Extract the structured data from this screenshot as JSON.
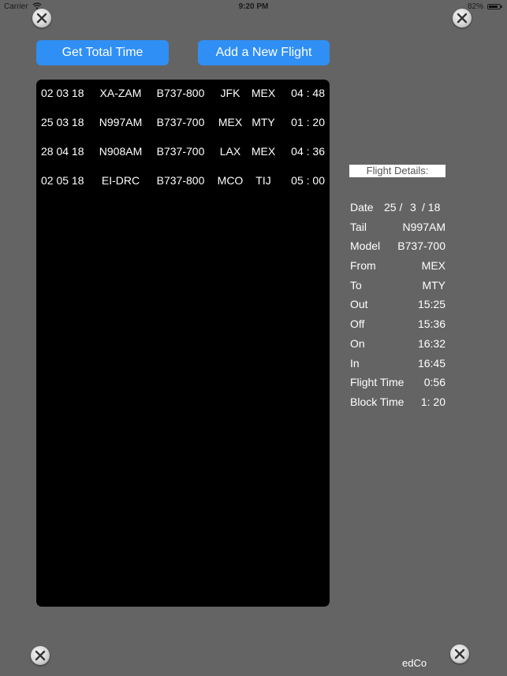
{
  "status_bar": {
    "carrier": "Carrier",
    "time": "9:20 PM",
    "battery_percent": "82%",
    "battery_level": 0.82
  },
  "toolbar": {
    "get_total_time_label": "Get Total Time",
    "add_flight_label": "Add a New Flight"
  },
  "flights": [
    {
      "date": "02 03 18",
      "tail": "XA-ZAM",
      "model": "B737-800",
      "from": "JFK",
      "to": "MEX",
      "time": "04 : 48"
    },
    {
      "date": "25 03 18",
      "tail": "N997AM",
      "model": "B737-700",
      "from": "MEX",
      "to": "MTY",
      "time": "01 : 20"
    },
    {
      "date": "28 04 18",
      "tail": "N908AM",
      "model": "B737-700",
      "from": "LAX",
      "to": "MEX",
      "time": "04 : 36"
    },
    {
      "date": "02 05 18",
      "tail": "EI-DRC",
      "model": "B737-800",
      "from": "MCO",
      "to": "TIJ",
      "time": "05 : 00"
    }
  ],
  "details": {
    "header": "Flight Details:",
    "date_label": "Date",
    "date_day": "25 /",
    "date_month": "3",
    "date_year": "/ 18",
    "fields": [
      {
        "label": "Tail",
        "value": "N997AM"
      },
      {
        "label": "Model",
        "value": "B737-700"
      },
      {
        "label": "From",
        "value": "MEX"
      },
      {
        "label": "To",
        "value": "MTY"
      },
      {
        "label": "Out",
        "value": "15:25"
      },
      {
        "label": "Off",
        "value": "15:36"
      },
      {
        "label": "On",
        "value": "16:32"
      },
      {
        "label": "In",
        "value": "16:45"
      },
      {
        "label": "Flight Time",
        "value": "0:56"
      },
      {
        "label": "Block Time",
        "value": "1: 20"
      }
    ]
  },
  "footer": {
    "brand": "edCo"
  },
  "colors": {
    "background": "#646464",
    "button": "#2f8ff5",
    "table_bg": "#000000"
  }
}
